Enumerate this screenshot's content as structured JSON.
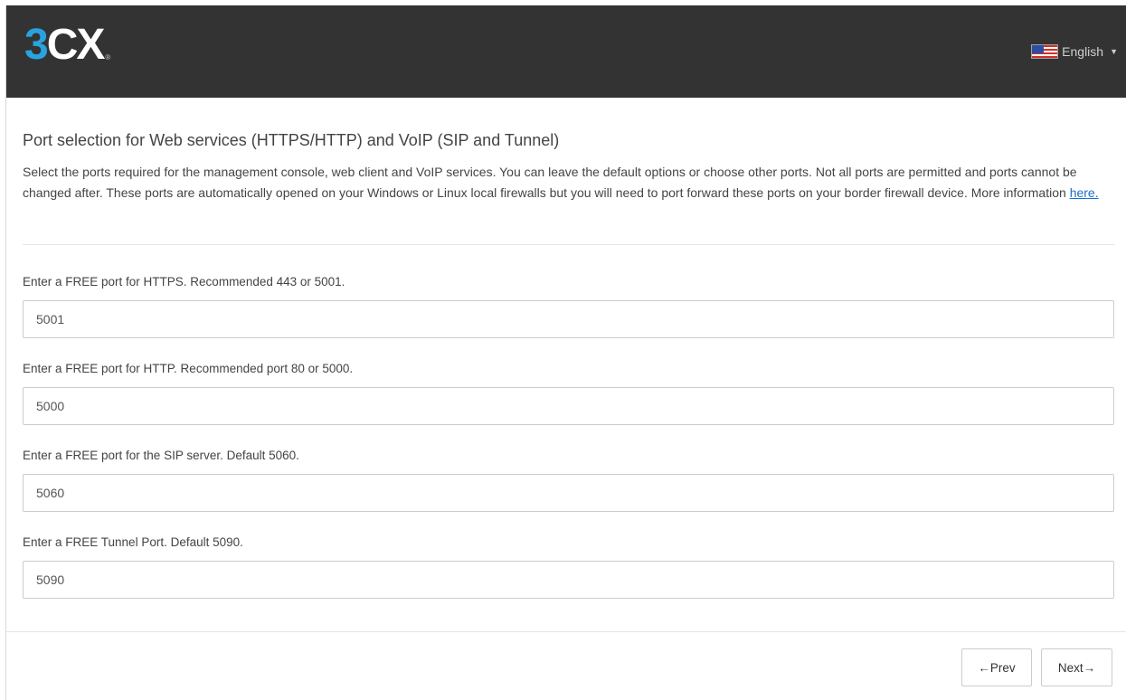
{
  "header": {
    "logo_three": "3",
    "logo_cx": "CX",
    "logo_mark": "®",
    "language": "English"
  },
  "main": {
    "title": "Port selection for Web services (HTTPS/HTTP) and VoIP (SIP and Tunnel)",
    "intro": "Select the ports required for the management console, web client and VoIP services. You can leave the default options or choose other ports. Not all ports are permitted and ports cannot be changed after. These ports are automatically opened on your Windows or Linux local firewalls but you will need to port forward these ports on your border firewall device. More information ",
    "intro_link": "here.",
    "fields": [
      {
        "label": "Enter a FREE port for HTTPS. Recommended 443 or 5001.",
        "value": "5001"
      },
      {
        "label": "Enter a FREE port for HTTP. Recommended port 80 or 5000.",
        "value": "5000"
      },
      {
        "label": "Enter a FREE port for the SIP server. Default 5060.",
        "value": "5060"
      },
      {
        "label": "Enter a FREE Tunnel Port. Default 5090.",
        "value": "5090"
      }
    ]
  },
  "footer": {
    "prev_label": "←Prev",
    "next_label": "Next→"
  },
  "colors": {
    "header_bg": "#333333",
    "logo_blue": "#29a3e0",
    "link": "#1a6fc9"
  },
  "icons": [
    "us-flag-icon",
    "caret-down-icon"
  ]
}
